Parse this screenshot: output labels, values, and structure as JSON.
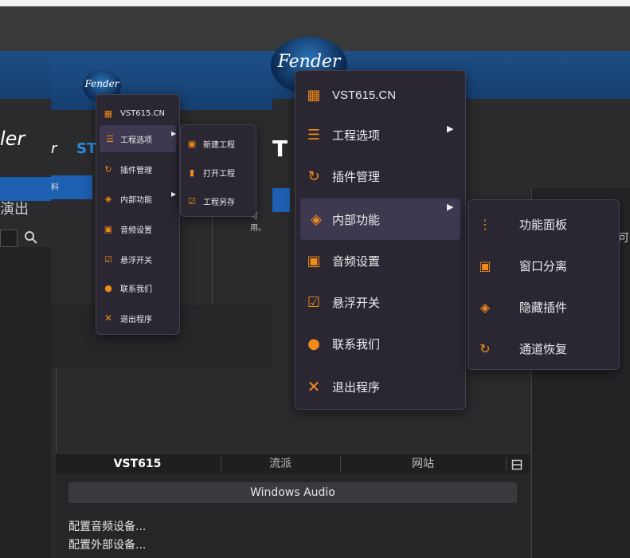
{
  "background_app": {
    "left_fragments": {
      "hdr": "ler",
      "st": "ST",
      "out": "演出",
      "ha": "料"
    },
    "tabs": [
      "VST615",
      "流派",
      "网站"
    ],
    "audio_device": "Windows Audio",
    "config_items": [
      "配置音频设备...",
      "配置外部设备..."
    ],
    "fragment_right": "可",
    "fragment_small": "可用。"
  },
  "logo_text": "Fender",
  "logo_sub": "ST",
  "small_shot": {
    "main_menu": [
      {
        "label": "VST615.CN",
        "icon": "grid-icon"
      },
      {
        "label": "工程选项",
        "icon": "menu-lines-icon",
        "submenu": true
      },
      {
        "label": "插件管理",
        "icon": "refresh-icon"
      },
      {
        "label": "内部功能",
        "icon": "plugin-icon",
        "submenu": true
      },
      {
        "label": "音频设置",
        "icon": "audio-icon"
      },
      {
        "label": "悬浮开关",
        "icon": "checkbox-icon"
      },
      {
        "label": "联系我们",
        "icon": "user-icon"
      },
      {
        "label": "退出程序",
        "icon": "close-icon"
      }
    ],
    "submenu": [
      {
        "label": "新建工程",
        "icon": "new-project-icon"
      },
      {
        "label": "打开工程",
        "icon": "bookmark-icon"
      },
      {
        "label": "工程另存",
        "icon": "save-as-icon"
      }
    ],
    "left_st": "ST",
    "left_fr": "r"
  },
  "big_menu": {
    "items": [
      {
        "label": "VST615.CN",
        "icon": "grid-icon"
      },
      {
        "label": "工程选项",
        "icon": "menu-lines-icon",
        "submenu": true
      },
      {
        "label": "插件管理",
        "icon": "refresh-icon"
      },
      {
        "label": "内部功能",
        "icon": "plugin-icon",
        "submenu": true
      },
      {
        "label": "音频设置",
        "icon": "audio-icon"
      },
      {
        "label": "悬浮开关",
        "icon": "checkbox-icon"
      },
      {
        "label": "联系我们",
        "icon": "user-icon"
      },
      {
        "label": "退出程序",
        "icon": "close-icon"
      }
    ],
    "submenu": [
      {
        "label": "功能面板",
        "icon": "dots-icon"
      },
      {
        "label": "窗口分离",
        "icon": "window-split-icon"
      },
      {
        "label": "隐藏插件",
        "icon": "plugin-icon"
      },
      {
        "label": "通道恢复",
        "icon": "refresh-icon"
      }
    ],
    "st_fragment": "T"
  },
  "colors": {
    "accent": "#f08a1a",
    "menu_bg": "#2a2632",
    "highlight": "#3e3850",
    "blue": "#1d4e86"
  }
}
